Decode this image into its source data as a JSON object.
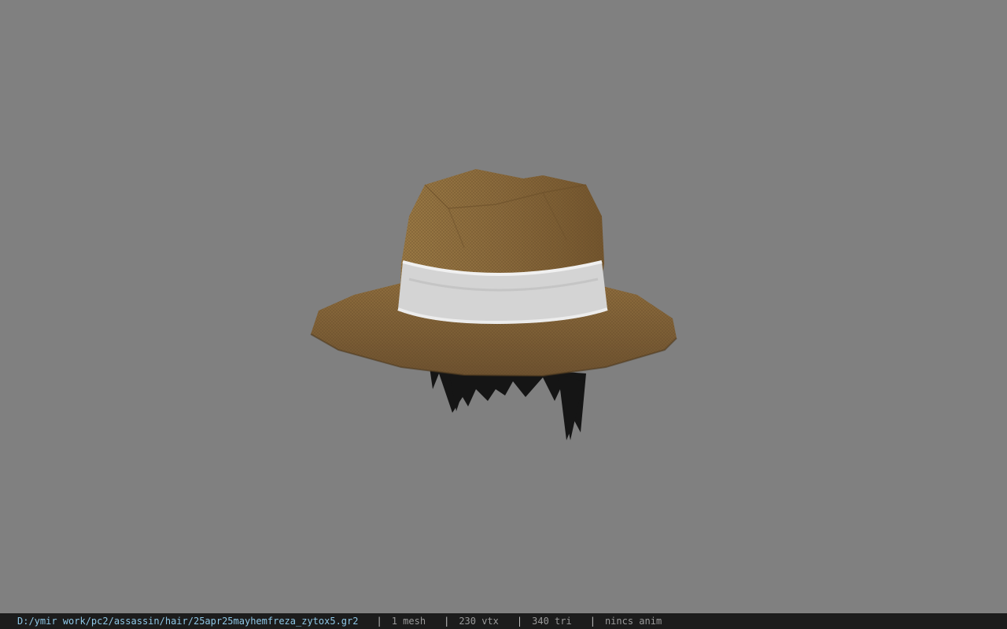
{
  "viewer": {
    "background_color": "#808080",
    "model_icon": "straw-hat-with-hair-model"
  },
  "statusbar": {
    "path": "D:/ymir work/pc2/assassin/hair/25apr25mayhemfreza_zytox5.gr2",
    "separator": "|",
    "mesh": "1 mesh",
    "vertices": "230 vtx",
    "triangles": "340 tri",
    "anim": "nincs anim"
  },
  "colors": {
    "hat_brown": "#8a6a3c",
    "band_white": "#d8d8d8",
    "hair_black": "#1a1a1a",
    "statusbar_bg": "#1c1c1c",
    "path_text": "#8ec7e6"
  }
}
